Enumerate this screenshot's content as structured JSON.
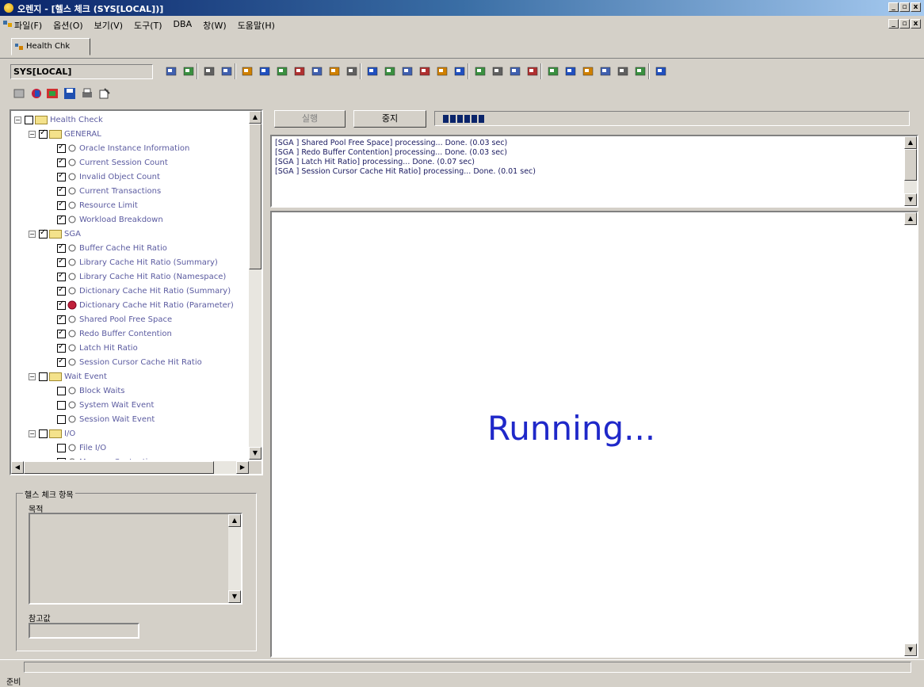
{
  "window": {
    "title": "오렌지 - [헬스 체크 (SYS[LOCAL])]",
    "min": "_",
    "restore": "▫",
    "close": "x"
  },
  "menu": {
    "items": [
      "파일(F)",
      "옵션(O)",
      "보기(V)",
      "도구(T)",
      "DBA",
      "창(W)",
      "도움말(H)"
    ]
  },
  "tabs": {
    "doc_tab": "Health Chk"
  },
  "connection": {
    "label": "SYS[LOCAL]"
  },
  "tree": {
    "root": "Health Check",
    "groups": [
      {
        "label": "GENERAL",
        "checked": true,
        "items": [
          {
            "label": "Oracle Instance Information",
            "checked": true
          },
          {
            "label": "Current Session Count",
            "checked": true
          },
          {
            "label": "Invalid Object Count",
            "checked": true
          },
          {
            "label": "Current Transactions",
            "checked": true
          },
          {
            "label": "Resource Limit",
            "checked": true
          },
          {
            "label": "Workload Breakdown",
            "checked": true
          }
        ]
      },
      {
        "label": "SGA",
        "checked": true,
        "items": [
          {
            "label": "Buffer Cache Hit Ratio",
            "checked": true
          },
          {
            "label": "Library Cache Hit Ratio (Summary)",
            "checked": true
          },
          {
            "label": "Library Cache Hit Ratio (Namespace)",
            "checked": true
          },
          {
            "label": "Dictionary Cache Hit Ratio (Summary)",
            "checked": true
          },
          {
            "label": "Dictionary Cache Hit Ratio (Parameter)",
            "checked": true,
            "active": true
          },
          {
            "label": "Shared Pool Free Space",
            "checked": true
          },
          {
            "label": "Redo Buffer Contention",
            "checked": true
          },
          {
            "label": "Latch Hit Ratio",
            "checked": true
          },
          {
            "label": "Session Cursor Cache Hit Ratio",
            "checked": true
          }
        ]
      },
      {
        "label": "Wait Event",
        "checked": false,
        "items": [
          {
            "label": "Block Waits",
            "checked": false
          },
          {
            "label": "System Wait Event",
            "checked": false
          },
          {
            "label": "Session Wait Event",
            "checked": false
          }
        ]
      },
      {
        "label": "I/O",
        "checked": false,
        "items": [
          {
            "label": "File I/O",
            "checked": false
          },
          {
            "label": "Memory Contention",
            "checked": false
          }
        ]
      }
    ]
  },
  "details": {
    "group_title": "헬스 체크 항목",
    "purpose_label": "목적",
    "reference_label": "참고값",
    "reference_value": ""
  },
  "controls": {
    "start_button": "실행",
    "stop_button": "중지",
    "progress_blocks": 6
  },
  "log": {
    "lines": [
      "[SGA ] Shared Pool Free Space] processing...  Done.  (0.03 sec)",
      "[SGA ] Redo Buffer Contention] processing...  Done.  (0.03 sec)",
      "[SGA ] Latch Hit Ratio] processing...  Done.  (0.07 sec)",
      "[SGA ] Session Cursor Cache Hit Ratio] processing...  Done.  (0.01 sec)"
    ]
  },
  "result": {
    "status_text": "Running..."
  },
  "statusbar": {
    "text": "준비"
  }
}
